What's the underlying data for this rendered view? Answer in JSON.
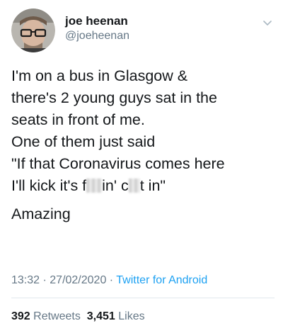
{
  "user": {
    "display_name": "joe heenan",
    "handle": "@joeheenan",
    "avatar_icon": "user-avatar-photo"
  },
  "menu_icon": "chevron-down-icon",
  "tweet": {
    "line1": "I'm on a bus in Glasgow &",
    "line2": "there's 2 young guys sat in the",
    "line3": "seats in front of me.",
    "line4": "One of them just said",
    "line5": "\"If that Coronavirus comes here",
    "line6_part1": "I'll kick it's f",
    "line6_part2": "in' c",
    "line6_part3": "t in\"",
    "line7": "Amazing"
  },
  "meta": {
    "time": "13:32",
    "separator": " · ",
    "date": "27/02/2020",
    "source": "Twitter for Android"
  },
  "stats": {
    "retweets_count": "392",
    "retweets_label": "Retweets",
    "likes_count": "3,451",
    "likes_label": "Likes"
  },
  "colors": {
    "text": "#14171a",
    "secondary": "#657786",
    "link": "#1da1f2",
    "divider": "#e1e8ed"
  }
}
